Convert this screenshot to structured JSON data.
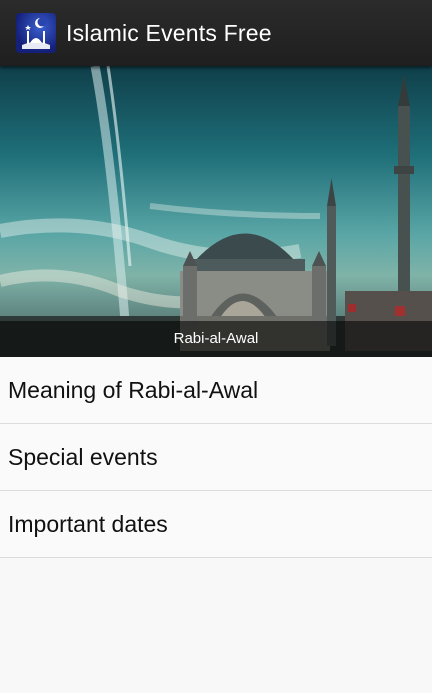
{
  "app": {
    "title": "Islamic Events Free",
    "icon": "mosque-crescent-icon"
  },
  "banner": {
    "caption": "Rabi-al-Awal",
    "image": "mosque-skyline-image"
  },
  "menu": {
    "items": [
      {
        "label": "Meaning of Rabi-al-Awal"
      },
      {
        "label": "Special events"
      },
      {
        "label": "Important dates"
      }
    ]
  },
  "colors": {
    "action_bar": "#222222",
    "list_background": "#fafafa",
    "divider": "#dcdcdc"
  }
}
